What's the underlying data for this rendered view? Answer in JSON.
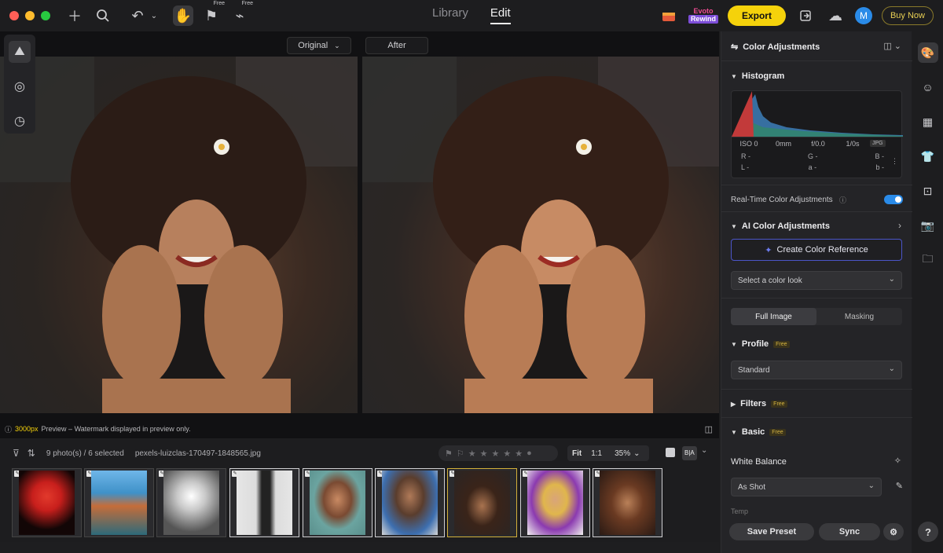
{
  "toolbar": {
    "free_label_1": "Free",
    "free_label_2": "Free",
    "tabs": [
      {
        "label": "Library"
      },
      {
        "label": "Edit"
      }
    ],
    "rewind_line1": "Evoto",
    "rewind_line2": "Rewind",
    "export_label": "Export",
    "avatar_initial": "M",
    "buy_label": "Buy Now"
  },
  "canvas": {
    "original_label": "Original",
    "after_label": "After",
    "preview_px": "3000px",
    "preview_note": "Preview – Watermark displayed in preview only."
  },
  "filmstrip": {
    "count_text": "9 photo(s) / 6 selected",
    "filename": "pexels-luizclas-170497-1848565.jpg",
    "fit_label": "Fit",
    "ratio_label": "1:1",
    "zoom": "35%",
    "compare_toggle": "B|A"
  },
  "panel": {
    "title": "Color Adjustments",
    "histogram": {
      "title": "Histogram",
      "iso": "ISO 0",
      "focal": "0mm",
      "aperture": "f/0.0",
      "shutter": "1/0s",
      "format": "JPG",
      "r": "R -",
      "g": "G -",
      "b": "B -",
      "l": "L -",
      "a": "a -",
      "bb": "b -"
    },
    "realtime_label": "Real-Time Color Adjustments",
    "realtime_on": true,
    "ai_title": "AI Color Adjustments",
    "create_ref_label": "Create Color Reference",
    "color_look_placeholder": "Select a color look",
    "seg_full": "Full Image",
    "seg_mask": "Masking",
    "profile_title": "Profile",
    "free_badge": "Free",
    "profile_value": "Standard",
    "filters_title": "Filters",
    "basic_title": "Basic",
    "wb_label": "White Balance",
    "wb_value": "As Shot",
    "temp_label": "Temp",
    "save_preset": "Save Preset",
    "sync": "Sync"
  },
  "rail": {
    "help": "?"
  },
  "colors": {
    "accent_yellow": "#f5d20b",
    "accent_blue": "#2a8be8",
    "panel_bg": "#242427"
  }
}
